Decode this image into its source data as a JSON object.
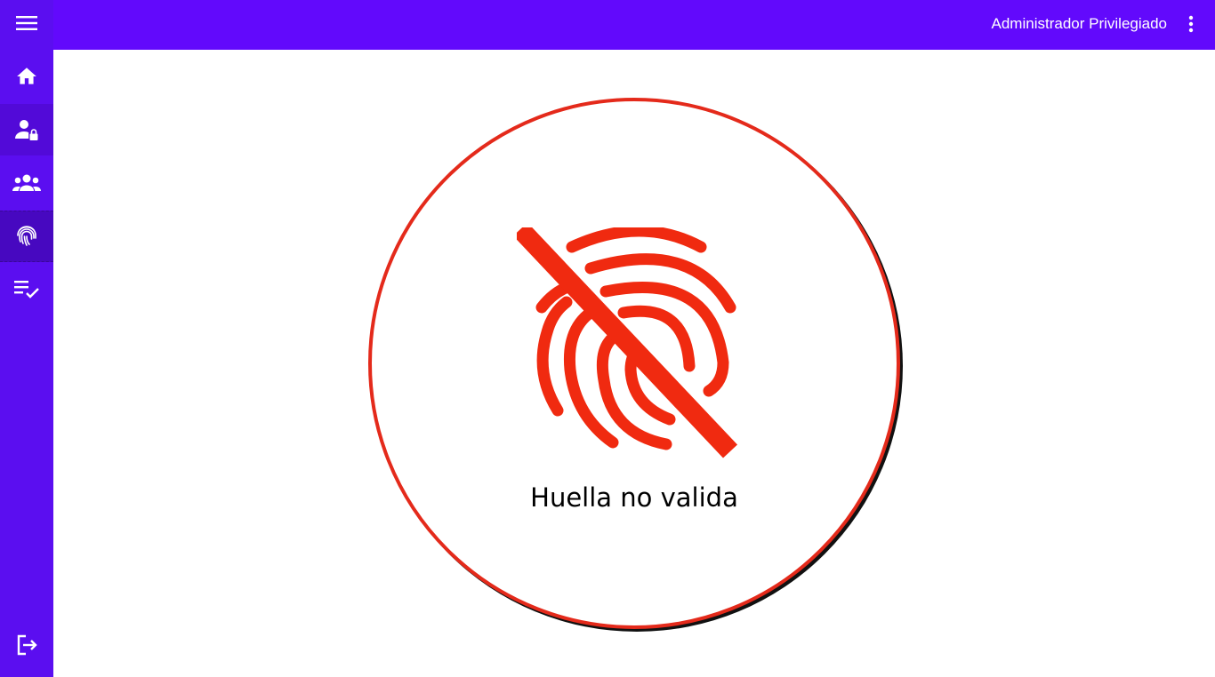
{
  "header": {
    "user_name": "Administrador Privilegiado"
  },
  "sidebar": {
    "items": [
      {
        "name": "home",
        "icon": "home-icon"
      },
      {
        "name": "users-lock",
        "icon": "user-lock-icon"
      },
      {
        "name": "groups",
        "icon": "group-icon"
      },
      {
        "name": "fingerprint",
        "icon": "fingerprint-icon",
        "active": true
      },
      {
        "name": "checklist",
        "icon": "checklist-icon"
      }
    ],
    "bottom": {
      "name": "logout",
      "icon": "logout-icon"
    }
  },
  "status": {
    "message": "Huella no valida",
    "icon": "fingerprint-off-icon"
  },
  "colors": {
    "sidebar": "#5b0ef0",
    "topbar": "#6209fc",
    "error": "#e42a1b"
  }
}
